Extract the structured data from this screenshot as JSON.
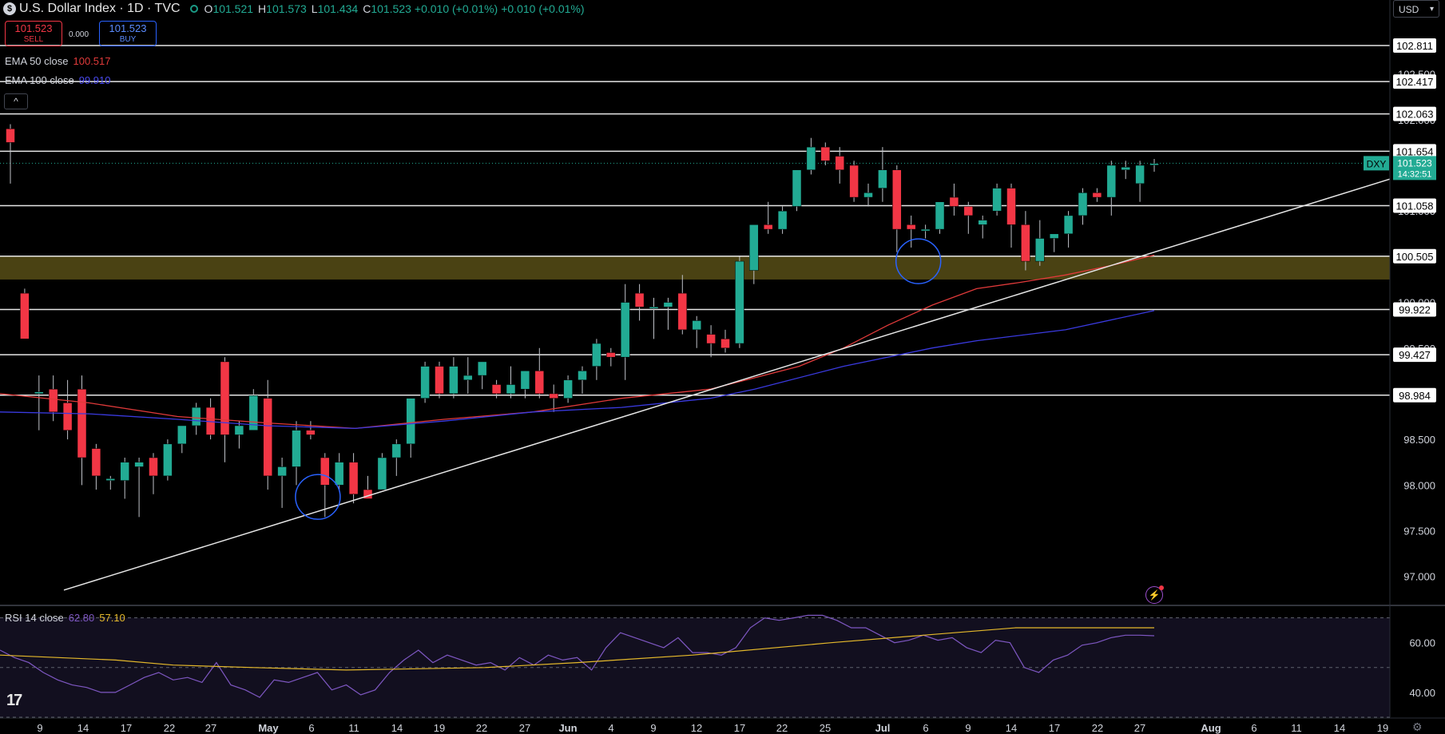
{
  "header": {
    "logo": "$",
    "title": "U.S. Dollar Index · 1D · TVC",
    "open_label": "O",
    "open": "101.521",
    "high_label": "H",
    "high": "101.573",
    "low_label": "L",
    "low": "101.434",
    "close_label": "C",
    "close": "101.523",
    "change": "+0.010 (+0.01%)",
    "change2": "+0.010 (+0.01%)"
  },
  "trade": {
    "sell_price": "101.523",
    "sell_label": "SELL",
    "spread": "0.000",
    "buy_price": "101.523",
    "buy_label": "BUY"
  },
  "indicators": {
    "ema50_label": "EMA 50 close",
    "ema50_value": "100.517",
    "ema100_label": "EMA 100 close",
    "ema100_value": "99.910",
    "rsi_label": "RSI 14 close",
    "rsi_value": "62.80",
    "rsi_ma_value": "57.10",
    "collapse_icon": "^"
  },
  "currency_selector": "USD",
  "symbol_tag": "DXY",
  "countdown": "14:32:51",
  "colors": {
    "up": "#22ab94",
    "down": "#f23645",
    "ema50": "#e03a3a",
    "ema100": "#3a3ae0",
    "rsi": "#7e57c2",
    "rsi_ma": "#e5b92b",
    "zone": "#4a4213",
    "circle": "#2962ff"
  },
  "chart_data": {
    "type": "candlestick",
    "symbol": "DXY",
    "price_axis_ticks": [
      "102.500",
      "102.000",
      "101.500",
      "101.000",
      "100.500",
      "100.000",
      "99.500",
      "99.000",
      "98.500",
      "98.000",
      "97.500",
      "97.000"
    ],
    "y_range": [
      96.7,
      103.1
    ],
    "horizontal_levels": [
      102.811,
      102.417,
      102.063,
      101.654,
      101.058,
      100.505,
      99.922,
      99.427,
      98.984
    ],
    "zone": [
      100.25,
      100.505
    ],
    "current_price": 101.523,
    "date_axis_labels": [
      "9",
      "14",
      "17",
      "22",
      "27",
      "May",
      "6",
      "11",
      "14",
      "19",
      "22",
      "27",
      "Jun",
      "4",
      "9",
      "12",
      "17",
      "22",
      "25",
      "Jul",
      "6",
      "9",
      "14",
      "17",
      "22",
      "27",
      "Aug",
      "6",
      "11",
      "14",
      "19"
    ],
    "candles": [
      {
        "o": 101.9,
        "h": 101.95,
        "l": 101.3,
        "c": 101.75
      },
      {
        "o": 100.1,
        "h": 100.15,
        "l": 99.6,
        "c": 99.6
      },
      {
        "o": 99.0,
        "h": 99.2,
        "l": 98.6,
        "c": 99.02
      },
      {
        "o": 99.05,
        "h": 99.2,
        "l": 98.7,
        "c": 98.8
      },
      {
        "o": 98.9,
        "h": 99.15,
        "l": 98.5,
        "c": 98.6
      },
      {
        "o": 99.05,
        "h": 99.2,
        "l": 98.0,
        "c": 98.3
      },
      {
        "o": 98.4,
        "h": 98.45,
        "l": 97.95,
        "c": 98.1
      },
      {
        "o": 98.05,
        "h": 98.1,
        "l": 97.95,
        "c": 98.07
      },
      {
        "o": 98.05,
        "h": 98.3,
        "l": 97.85,
        "c": 98.25
      },
      {
        "o": 98.2,
        "h": 98.3,
        "l": 97.65,
        "c": 98.25
      },
      {
        "o": 98.3,
        "h": 98.35,
        "l": 97.9,
        "c": 98.1
      },
      {
        "o": 98.1,
        "h": 98.5,
        "l": 98.05,
        "c": 98.45
      },
      {
        "o": 98.45,
        "h": 98.65,
        "l": 98.35,
        "c": 98.65
      },
      {
        "o": 98.65,
        "h": 98.9,
        "l": 98.55,
        "c": 98.85
      },
      {
        "o": 98.85,
        "h": 98.95,
        "l": 98.5,
        "c": 98.55
      },
      {
        "o": 99.35,
        "h": 99.4,
        "l": 98.25,
        "c": 98.55
      },
      {
        "o": 98.55,
        "h": 98.7,
        "l": 98.4,
        "c": 98.65
      },
      {
        "o": 98.6,
        "h": 99.05,
        "l": 98.6,
        "c": 98.98
      },
      {
        "o": 98.95,
        "h": 99.15,
        "l": 97.95,
        "c": 98.1
      },
      {
        "o": 98.1,
        "h": 98.3,
        "l": 97.75,
        "c": 98.2
      },
      {
        "o": 98.2,
        "h": 98.7,
        "l": 98.0,
        "c": 98.6
      },
      {
        "o": 98.6,
        "h": 98.7,
        "l": 98.5,
        "c": 98.55
      },
      {
        "o": 98.3,
        "h": 98.35,
        "l": 97.65,
        "c": 98.0
      },
      {
        "o": 98.0,
        "h": 98.35,
        "l": 97.95,
        "c": 98.25
      },
      {
        "o": 98.25,
        "h": 98.35,
        "l": 97.8,
        "c": 97.9
      },
      {
        "o": 97.95,
        "h": 98.1,
        "l": 97.85,
        "c": 97.85
      },
      {
        "o": 97.95,
        "h": 98.35,
        "l": 97.95,
        "c": 98.3
      },
      {
        "o": 98.3,
        "h": 98.5,
        "l": 98.1,
        "c": 98.45
      },
      {
        "o": 98.45,
        "h": 98.95,
        "l": 98.3,
        "c": 98.95
      },
      {
        "o": 98.95,
        "h": 99.35,
        "l": 98.9,
        "c": 99.3
      },
      {
        "o": 99.3,
        "h": 99.35,
        "l": 98.95,
        "c": 99.0
      },
      {
        "o": 99.0,
        "h": 99.4,
        "l": 98.95,
        "c": 99.3
      },
      {
        "o": 99.15,
        "h": 99.4,
        "l": 99.0,
        "c": 99.2
      },
      {
        "o": 99.2,
        "h": 99.35,
        "l": 99.05,
        "c": 99.35
      },
      {
        "o": 99.1,
        "h": 99.15,
        "l": 98.95,
        "c": 99.0
      },
      {
        "o": 99.0,
        "h": 99.3,
        "l": 98.95,
        "c": 99.1
      },
      {
        "o": 99.05,
        "h": 99.25,
        "l": 98.95,
        "c": 99.25
      },
      {
        "o": 99.25,
        "h": 99.5,
        "l": 98.95,
        "c": 99.0
      },
      {
        "o": 99.0,
        "h": 99.1,
        "l": 98.8,
        "c": 98.95
      },
      {
        "o": 98.95,
        "h": 99.2,
        "l": 98.9,
        "c": 99.15
      },
      {
        "o": 99.15,
        "h": 99.3,
        "l": 99.0,
        "c": 99.25
      },
      {
        "o": 99.3,
        "h": 99.6,
        "l": 99.15,
        "c": 99.55
      },
      {
        "o": 99.45,
        "h": 99.5,
        "l": 99.3,
        "c": 99.4
      },
      {
        "o": 99.4,
        "h": 100.2,
        "l": 99.15,
        "c": 100.0
      },
      {
        "o": 100.1,
        "h": 100.2,
        "l": 99.8,
        "c": 99.95
      },
      {
        "o": 99.95,
        "h": 100.05,
        "l": 99.6,
        "c": 99.95
      },
      {
        "o": 99.95,
        "h": 100.05,
        "l": 99.7,
        "c": 100.0
      },
      {
        "o": 100.1,
        "h": 100.3,
        "l": 99.65,
        "c": 99.7
      },
      {
        "o": 99.7,
        "h": 99.85,
        "l": 99.5,
        "c": 99.8
      },
      {
        "o": 99.65,
        "h": 99.75,
        "l": 99.4,
        "c": 99.55
      },
      {
        "o": 99.6,
        "h": 99.7,
        "l": 99.45,
        "c": 99.5
      },
      {
        "o": 99.55,
        "h": 100.5,
        "l": 99.5,
        "c": 100.45
      },
      {
        "o": 100.35,
        "h": 100.85,
        "l": 100.2,
        "c": 100.85
      },
      {
        "o": 100.85,
        "h": 101.1,
        "l": 100.75,
        "c": 100.8
      },
      {
        "o": 100.8,
        "h": 101.05,
        "l": 100.75,
        "c": 101.0
      },
      {
        "o": 101.05,
        "h": 101.45,
        "l": 101.0,
        "c": 101.45
      },
      {
        "o": 101.45,
        "h": 101.8,
        "l": 101.4,
        "c": 101.7
      },
      {
        "o": 101.7,
        "h": 101.75,
        "l": 101.5,
        "c": 101.55
      },
      {
        "o": 101.6,
        "h": 101.7,
        "l": 101.3,
        "c": 101.45
      },
      {
        "o": 101.5,
        "h": 101.55,
        "l": 101.1,
        "c": 101.15
      },
      {
        "o": 101.15,
        "h": 101.3,
        "l": 101.05,
        "c": 101.2
      },
      {
        "o": 101.25,
        "h": 101.7,
        "l": 101.1,
        "c": 101.45
      },
      {
        "o": 101.45,
        "h": 101.5,
        "l": 100.55,
        "c": 100.8
      },
      {
        "o": 100.85,
        "h": 100.95,
        "l": 100.6,
        "c": 100.8
      },
      {
        "o": 100.8,
        "h": 100.85,
        "l": 100.7,
        "c": 100.8
      },
      {
        "o": 100.8,
        "h": 101.1,
        "l": 100.75,
        "c": 101.1
      },
      {
        "o": 101.15,
        "h": 101.3,
        "l": 100.95,
        "c": 101.05
      },
      {
        "o": 101.05,
        "h": 101.1,
        "l": 100.75,
        "c": 100.95
      },
      {
        "o": 100.85,
        "h": 100.95,
        "l": 100.7,
        "c": 100.9
      },
      {
        "o": 101.0,
        "h": 101.3,
        "l": 100.95,
        "c": 101.25
      },
      {
        "o": 101.25,
        "h": 101.3,
        "l": 100.6,
        "c": 100.85
      },
      {
        "o": 100.85,
        "h": 101.0,
        "l": 100.35,
        "c": 100.45
      },
      {
        "o": 100.45,
        "h": 100.9,
        "l": 100.4,
        "c": 100.7
      },
      {
        "o": 100.7,
        "h": 100.75,
        "l": 100.55,
        "c": 100.75
      },
      {
        "o": 100.75,
        "h": 101.0,
        "l": 100.6,
        "c": 100.95
      },
      {
        "o": 100.95,
        "h": 101.25,
        "l": 100.85,
        "c": 101.2
      },
      {
        "o": 101.2,
        "h": 101.25,
        "l": 101.1,
        "c": 101.15
      },
      {
        "o": 101.15,
        "h": 101.55,
        "l": 100.95,
        "c": 101.5
      },
      {
        "o": 101.45,
        "h": 101.55,
        "l": 101.35,
        "c": 101.48
      },
      {
        "o": 101.3,
        "h": 101.55,
        "l": 101.1,
        "c": 101.5
      },
      {
        "o": 101.52,
        "h": 101.57,
        "l": 101.43,
        "c": 101.52
      }
    ],
    "ema50": [
      [
        0,
        99.0
      ],
      [
        100,
        98.9
      ],
      [
        200,
        98.75
      ],
      [
        300,
        98.68
      ],
      [
        400,
        98.62
      ],
      [
        500,
        98.72
      ],
      [
        600,
        98.8
      ],
      [
        700,
        98.95
      ],
      [
        800,
        99.05
      ],
      [
        900,
        99.3
      ],
      [
        950,
        99.5
      ],
      [
        1000,
        99.75
      ],
      [
        1050,
        99.97
      ],
      [
        1100,
        100.15
      ],
      [
        1150,
        100.22
      ],
      [
        1200,
        100.3
      ],
      [
        1250,
        100.4
      ],
      [
        1300,
        100.517
      ]
    ],
    "ema100": [
      [
        0,
        98.8
      ],
      [
        100,
        98.78
      ],
      [
        200,
        98.72
      ],
      [
        300,
        98.65
      ],
      [
        400,
        98.62
      ],
      [
        500,
        98.7
      ],
      [
        600,
        98.8
      ],
      [
        700,
        98.85
      ],
      [
        800,
        98.95
      ],
      [
        850,
        99.05
      ],
      [
        950,
        99.3
      ],
      [
        1050,
        99.5
      ],
      [
        1100,
        99.58
      ],
      [
        1200,
        99.7
      ],
      [
        1300,
        99.91
      ]
    ],
    "trendline": [
      [
        5.0,
        96.9
      ],
      [
        100,
        101.7
      ]
    ],
    "circles": [
      [
        380,
        97.87
      ],
      [
        1120,
        100.45
      ]
    ],
    "rsi": {
      "ticks": [
        "60.00",
        "40.00"
      ],
      "range": [
        30,
        75
      ],
      "levels": [
        70,
        50,
        30
      ],
      "rsi_line": [
        57,
        54,
        52,
        48,
        45,
        43,
        42,
        40,
        40,
        43,
        46,
        48,
        45,
        46,
        44,
        52,
        43,
        41,
        38,
        45,
        44,
        46,
        48,
        41,
        43,
        39,
        41,
        48,
        53,
        57,
        52,
        55,
        53,
        51,
        52,
        49,
        54,
        51,
        55,
        53,
        54,
        49,
        58,
        64,
        62,
        60,
        58,
        62,
        56,
        56,
        55,
        58,
        66,
        70,
        69,
        70,
        71,
        71,
        69,
        66,
        66,
        63,
        60,
        61,
        63,
        61,
        62,
        58,
        56,
        61,
        60,
        50,
        48,
        53,
        55,
        59,
        60,
        62,
        63,
        63,
        62.8
      ],
      "ma_line": [
        [
          0,
          55
        ],
        [
          0.1,
          53
        ],
        [
          0.15,
          51
        ],
        [
          0.22,
          50
        ],
        [
          0.3,
          49
        ],
        [
          0.42,
          50
        ],
        [
          0.5,
          52
        ],
        [
          0.6,
          55
        ],
        [
          0.72,
          60
        ],
        [
          0.8,
          63
        ],
        [
          0.88,
          66
        ],
        [
          1.0,
          66
        ]
      ]
    }
  }
}
